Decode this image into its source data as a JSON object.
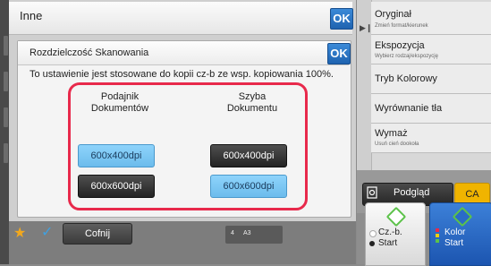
{
  "background": {
    "title": "Inne",
    "ok_label": "OK"
  },
  "dialog": {
    "title": "Rozdzielczość Skanowania",
    "ok_label": "OK",
    "description": "To ustawienie jest stosowane do kopii cz-b ze wsp. kopiowania 100%.",
    "columns": [
      {
        "heading_line1": "Podajnik",
        "heading_line2": "Dokumentów",
        "options": [
          {
            "label": "600x400dpi",
            "selected": true
          },
          {
            "label": "600x600dpi",
            "selected": false
          }
        ]
      },
      {
        "heading_line1": "Szyba",
        "heading_line2": "Dokumentu",
        "options": [
          {
            "label": "600x400dpi",
            "selected": false
          },
          {
            "label": "600x600dpi",
            "selected": true
          }
        ]
      }
    ]
  },
  "right_menu": {
    "items": [
      {
        "label": "Oryginał",
        "sublabel": "Zmień format/kierunek"
      },
      {
        "label": "Ekspozycja",
        "sublabel": "Wybierz rodzaj/ekspozycję"
      },
      {
        "label": "Tryb Kolorowy",
        "sublabel": ""
      },
      {
        "label": "Wyrównanie tła",
        "sublabel": ""
      },
      {
        "label": "Wymaż",
        "sublabel": "Usuń cień dookoła"
      }
    ]
  },
  "actions": {
    "preview_label": "Podgląd",
    "ca_label": "CA",
    "start_bw_line1": "Cz.-b.",
    "start_bw_line2": "Start",
    "start_color_line1": "Kolor",
    "start_color_line2": "Start"
  },
  "bottom_bar": {
    "back_label": "Cofnij",
    "page_num": "4",
    "paper_size": "A3"
  },
  "colors": {
    "accent_blue": "#1f63b0",
    "highlight_red": "#e8294b",
    "selected_option": "#8ed3fb",
    "ca_yellow": "#f0b400"
  },
  "icons": [
    "star-icon",
    "check-icon",
    "preview-icon",
    "diamond-icon",
    "collapse-arrow-icon"
  ]
}
